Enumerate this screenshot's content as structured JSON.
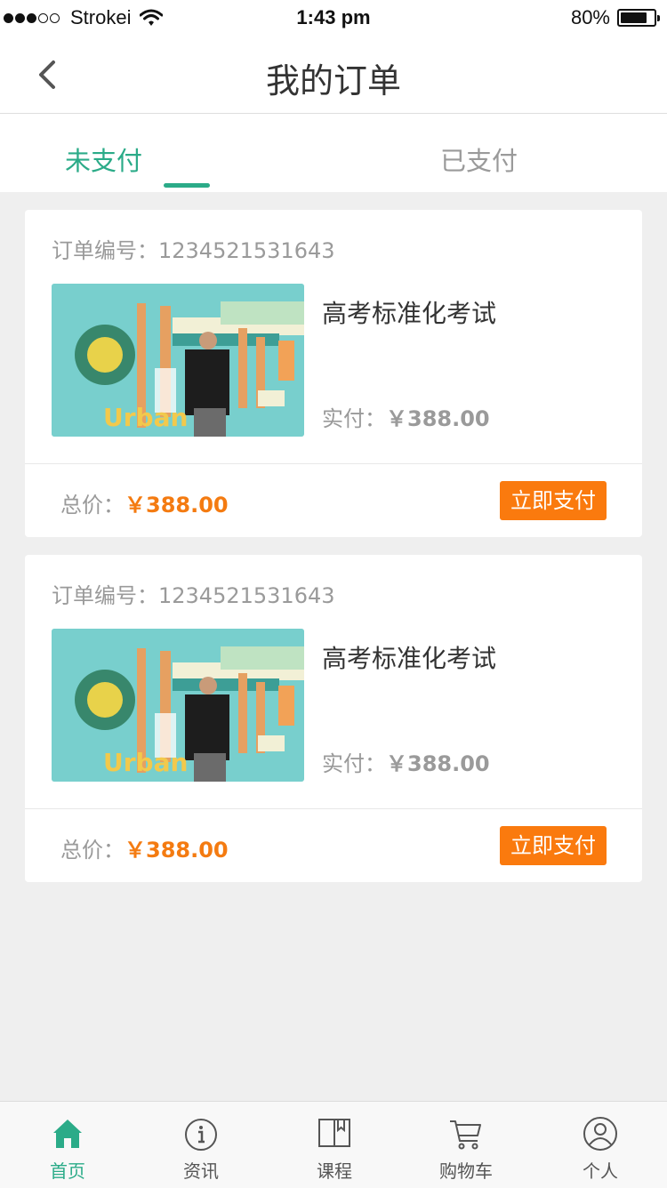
{
  "status_bar": {
    "carrier": "Strokei",
    "time": "1:43 pm",
    "battery": "80%",
    "battery_level": 0.8
  },
  "nav": {
    "title": "我的订单",
    "back_icon": "chevron-left-icon"
  },
  "tabs": [
    {
      "label": "未支付",
      "active": true
    },
    {
      "label": "已支付",
      "active": false
    }
  ],
  "orders": [
    {
      "order_number": "订单编号：1234521531643",
      "title": "高考标准化考试",
      "paid_label": "实付：",
      "paid_amount": "￥388.00",
      "total_label": "总价：",
      "total_amount": "￥388.00",
      "pay_button": "立即支付",
      "image_text": "Urban"
    },
    {
      "order_number": "订单编号：1234521531643",
      "title": "高考标准化考试",
      "paid_label": "实付：",
      "paid_amount": "￥388.00",
      "total_label": "总价：",
      "total_amount": "￥388.00",
      "pay_button": "立即支付",
      "image_text": "Urban"
    }
  ],
  "tab_bar": [
    {
      "label": "首页",
      "icon": "home-icon",
      "active": true
    },
    {
      "label": "资讯",
      "icon": "info-icon",
      "active": false
    },
    {
      "label": "课程",
      "icon": "book-icon",
      "active": false
    },
    {
      "label": "购物车",
      "icon": "cart-icon",
      "active": false
    },
    {
      "label": "个人",
      "icon": "user-icon",
      "active": false
    }
  ],
  "colors": {
    "accent": "#2bab88",
    "price": "#f47b11",
    "button": "#fa7a0e",
    "background": "#efefef"
  }
}
